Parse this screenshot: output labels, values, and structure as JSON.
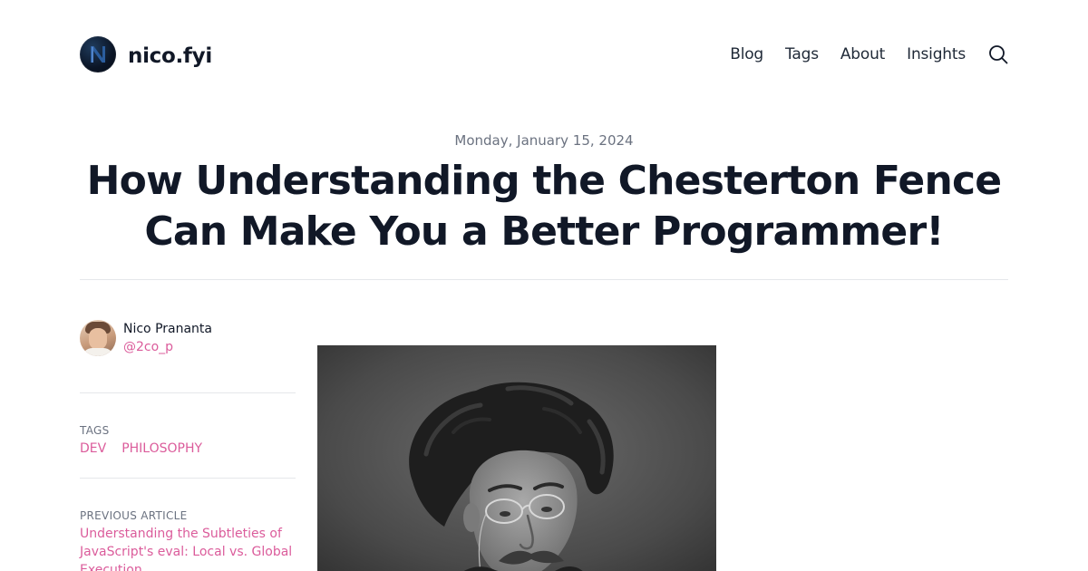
{
  "header": {
    "brand": "nico.fyi",
    "logo_icon": "n-monogram-logo",
    "nav": [
      "Blog",
      "Tags",
      "About",
      "Insights"
    ],
    "search_icon": "search-icon"
  },
  "post": {
    "date": "Monday, January 15, 2024",
    "title": "How Understanding the Chesterton Fence Can Make You a Better Programmer!"
  },
  "sidebar": {
    "author": {
      "name": "Nico Prananta",
      "handle": "@2co_p"
    },
    "tags_label": "TAGS",
    "tags": [
      "DEV",
      "PHILOSOPHY"
    ],
    "previous_label": "PREVIOUS ARTICLE",
    "previous_title": "Understanding the Subtleties of JavaScript's eval: Local vs. Global Execution"
  },
  "colors": {
    "accent": "#db5c9b",
    "text": "#111827",
    "muted": "#6b7280",
    "divider": "#e5e7eb"
  }
}
